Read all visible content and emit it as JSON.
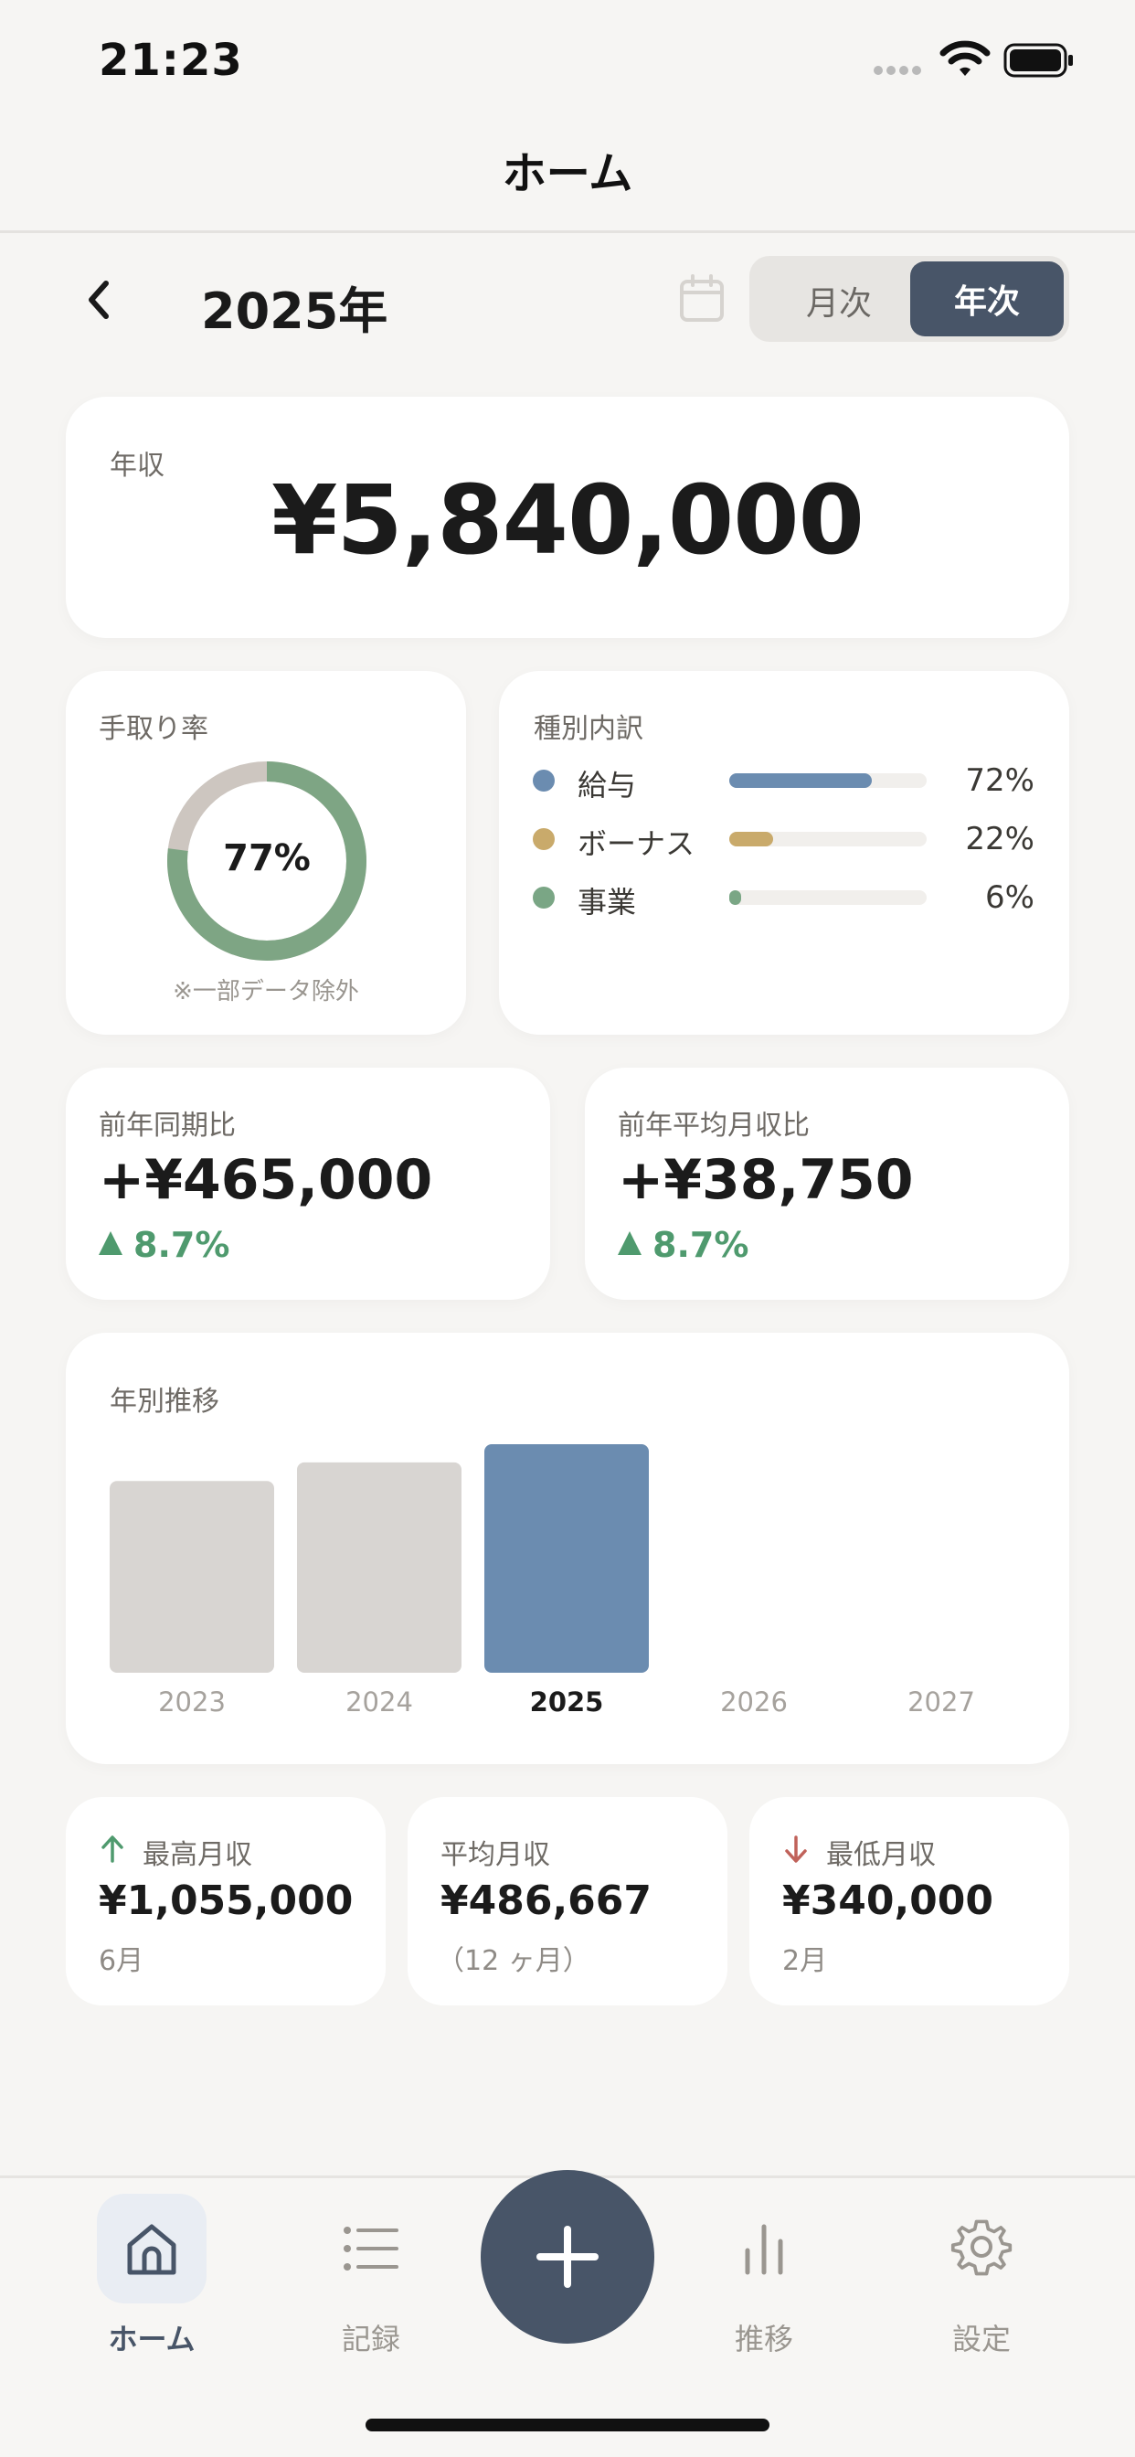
{
  "status_bar": {
    "time": "21:23"
  },
  "nav": {
    "title": "ホーム"
  },
  "header": {
    "year_title": "2025年",
    "segment_month": "月次",
    "segment_year": "年次"
  },
  "annual": {
    "label": "年収",
    "value": "¥5,840,000"
  },
  "takehome": {
    "label": "手取り率",
    "value": "77%",
    "percent": 77,
    "note": "※一部データ除外"
  },
  "breakdown": {
    "label": "種別内訳",
    "items": [
      {
        "name": "給与",
        "pct": "72%",
        "value": 72,
        "color": "#6b8cb0"
      },
      {
        "name": "ボーナス",
        "pct": "22%",
        "value": 22,
        "color": "#c9aa6b"
      },
      {
        "name": "事業",
        "pct": "6%",
        "value": 6,
        "color": "#7aa685"
      }
    ]
  },
  "yoy": {
    "label": "前年同期比",
    "value": "+¥465,000",
    "pct": "8.7%"
  },
  "avg_compare": {
    "label": "前年平均月収比",
    "value": "+¥38,750",
    "pct": "8.7%"
  },
  "trend": {
    "label": "年別推移"
  },
  "chart_data": {
    "type": "bar",
    "categories": [
      "2023",
      "2024",
      "2025",
      "2026",
      "2027"
    ],
    "values": [
      4900000,
      5375000,
      5840000,
      null,
      null
    ],
    "highlight": "2025",
    "colors": {
      "default": "#d8d5d2",
      "highlight": "#6b8cb0"
    }
  },
  "stats": {
    "max": {
      "label": "最高月収",
      "value": "¥1,055,000",
      "sub": "6月",
      "arrow_color": "#4f9a6e"
    },
    "avg": {
      "label": "平均月収",
      "value": "¥486,667",
      "sub": "（12 ヶ月）"
    },
    "min": {
      "label": "最低月収",
      "value": "¥340,000",
      "sub": "2月",
      "arrow_color": "#c0625a"
    }
  },
  "tabbar": {
    "home": "ホーム",
    "records": "記録",
    "trend": "推移",
    "settings": "設定"
  },
  "colors": {
    "accent": "#485568",
    "positive": "#4f9a6e",
    "negative": "#c0625a"
  }
}
